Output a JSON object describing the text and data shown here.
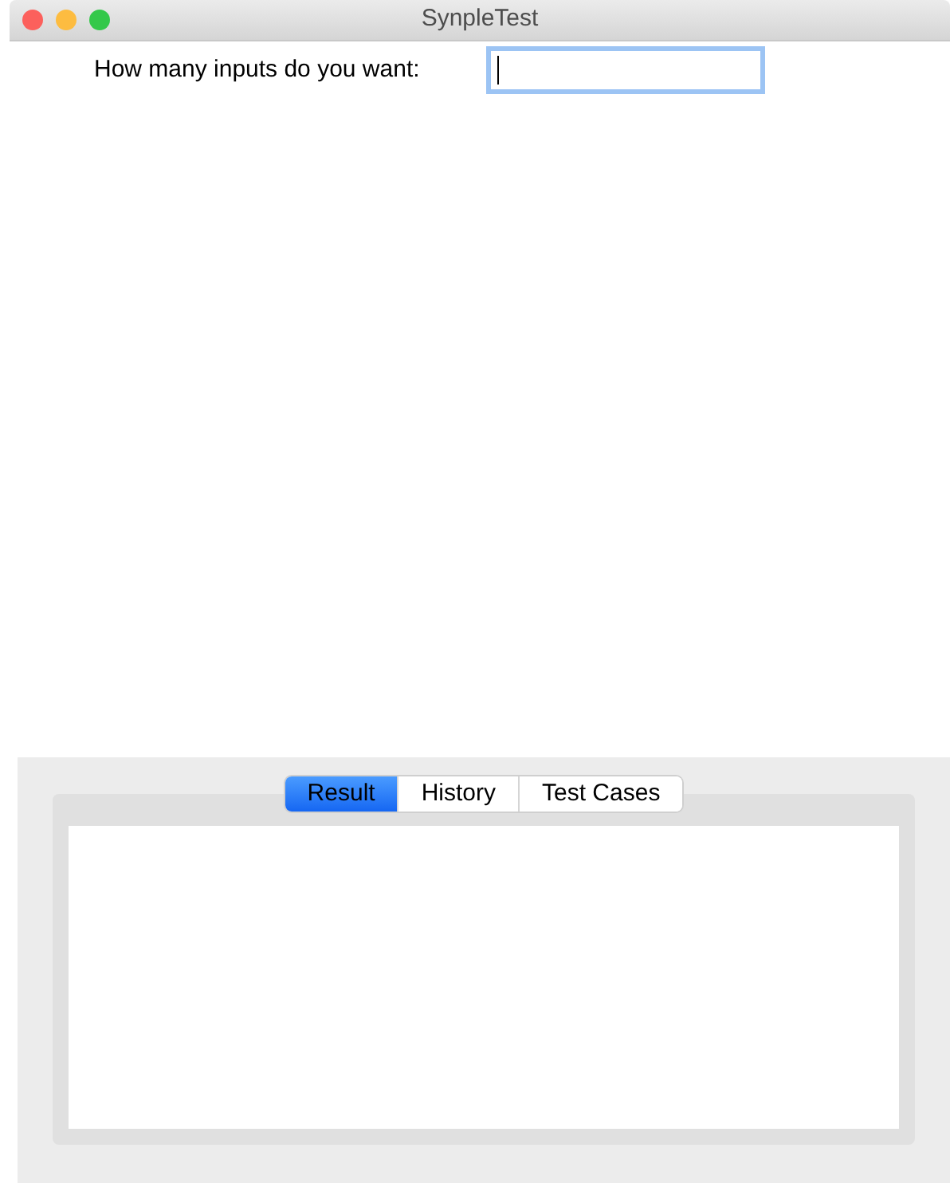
{
  "window": {
    "title": "SynpleTest"
  },
  "input": {
    "label": "How many inputs do you want:",
    "focused": true
  },
  "tabs": [
    {
      "label": "Result",
      "selected": true
    },
    {
      "label": "History",
      "selected": false
    },
    {
      "label": "Test Cases",
      "selected": false
    }
  ]
}
